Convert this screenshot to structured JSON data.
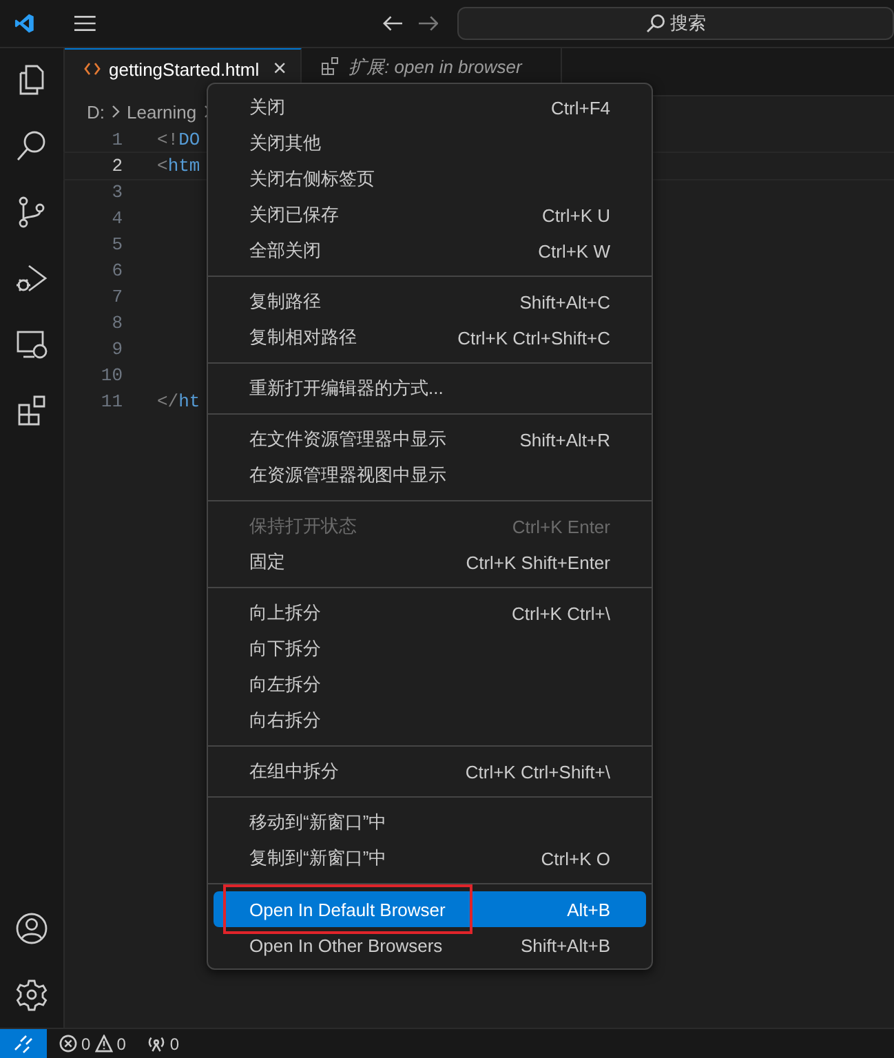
{
  "titlebar": {
    "search": {
      "placeholder": "搜索"
    }
  },
  "tabs": [
    {
      "label": "gettingStarted.html",
      "selected": true,
      "kind": "file",
      "close": "×"
    },
    {
      "label": "扩展: open in browser",
      "selected": false,
      "kind": "extension"
    }
  ],
  "breadcrumb": [
    "D:",
    "Learning"
  ],
  "editor": {
    "lines": [
      {
        "number": "1",
        "code": [
          {
            "text": "<!",
            "kind": "punct"
          },
          {
            "text": "DO",
            "kind": "tag"
          }
        ],
        "current": false
      },
      {
        "number": "2",
        "code": [
          {
            "text": "<",
            "kind": "punct"
          },
          {
            "text": "htm",
            "kind": "tag"
          }
        ],
        "current": true
      },
      {
        "number": "3",
        "current": false
      },
      {
        "number": "4",
        "current": false
      },
      {
        "number": "5",
        "current": false
      },
      {
        "number": "6",
        "current": false
      },
      {
        "number": "7",
        "current": false
      },
      {
        "number": "8",
        "current": false
      },
      {
        "number": "9",
        "current": false
      },
      {
        "number": "10",
        "current": false
      },
      {
        "number": "11",
        "code": [
          {
            "text": "</",
            "kind": "punct"
          },
          {
            "text": "ht",
            "kind": "tag"
          }
        ],
        "current": false
      }
    ]
  },
  "context_menu": {
    "groups": [
      [
        {
          "label": "关闭",
          "shortcut": "Ctrl+F4",
          "disabled": false,
          "selected": false
        },
        {
          "label": "关闭其他",
          "disabled": false,
          "selected": false
        },
        {
          "label": "关闭右侧标签页",
          "disabled": false,
          "selected": false
        },
        {
          "label": "关闭已保存",
          "shortcut": "Ctrl+K U",
          "disabled": false,
          "selected": false
        },
        {
          "label": "全部关闭",
          "shortcut": "Ctrl+K W",
          "disabled": false,
          "selected": false
        }
      ],
      [
        {
          "label": "复制路径",
          "shortcut": "Shift+Alt+C",
          "disabled": false,
          "selected": false
        },
        {
          "label": "复制相对路径",
          "shortcut": "Ctrl+K Ctrl+Shift+C",
          "disabled": false,
          "selected": false
        }
      ],
      [
        {
          "label": "重新打开编辑器的方式...",
          "disabled": false,
          "selected": false
        }
      ],
      [
        {
          "label": "在文件资源管理器中显示",
          "shortcut": "Shift+Alt+R",
          "disabled": false,
          "selected": false
        },
        {
          "label": "在资源管理器视图中显示",
          "disabled": false,
          "selected": false
        }
      ],
      [
        {
          "label": "保持打开状态",
          "shortcut": "Ctrl+K Enter",
          "disabled": true,
          "selected": false
        },
        {
          "label": "固定",
          "shortcut": "Ctrl+K Shift+Enter",
          "disabled": false,
          "selected": false
        }
      ],
      [
        {
          "label": "向上拆分",
          "shortcut": "Ctrl+K Ctrl+\\",
          "disabled": false,
          "selected": false
        },
        {
          "label": "向下拆分",
          "disabled": false,
          "selected": false
        },
        {
          "label": "向左拆分",
          "disabled": false,
          "selected": false
        },
        {
          "label": "向右拆分",
          "disabled": false,
          "selected": false
        }
      ],
      [
        {
          "label": "在组中拆分",
          "shortcut": "Ctrl+K Ctrl+Shift+\\",
          "disabled": false,
          "selected": false
        }
      ],
      [
        {
          "label": "移动到“新窗口”中",
          "disabled": false,
          "selected": false
        },
        {
          "label": "复制到“新窗口”中",
          "shortcut": "Ctrl+K O",
          "disabled": false,
          "selected": false
        }
      ],
      [
        {
          "label": "Open In Default Browser",
          "shortcut": "Alt+B",
          "disabled": false,
          "selected": true,
          "outlined": true
        },
        {
          "label": "Open In Other Browsers",
          "shortcut": "Shift+Alt+B",
          "disabled": false,
          "selected": false
        }
      ]
    ]
  },
  "status_bar": {
    "errors": "0",
    "warnings": "0",
    "ports": "0"
  }
}
